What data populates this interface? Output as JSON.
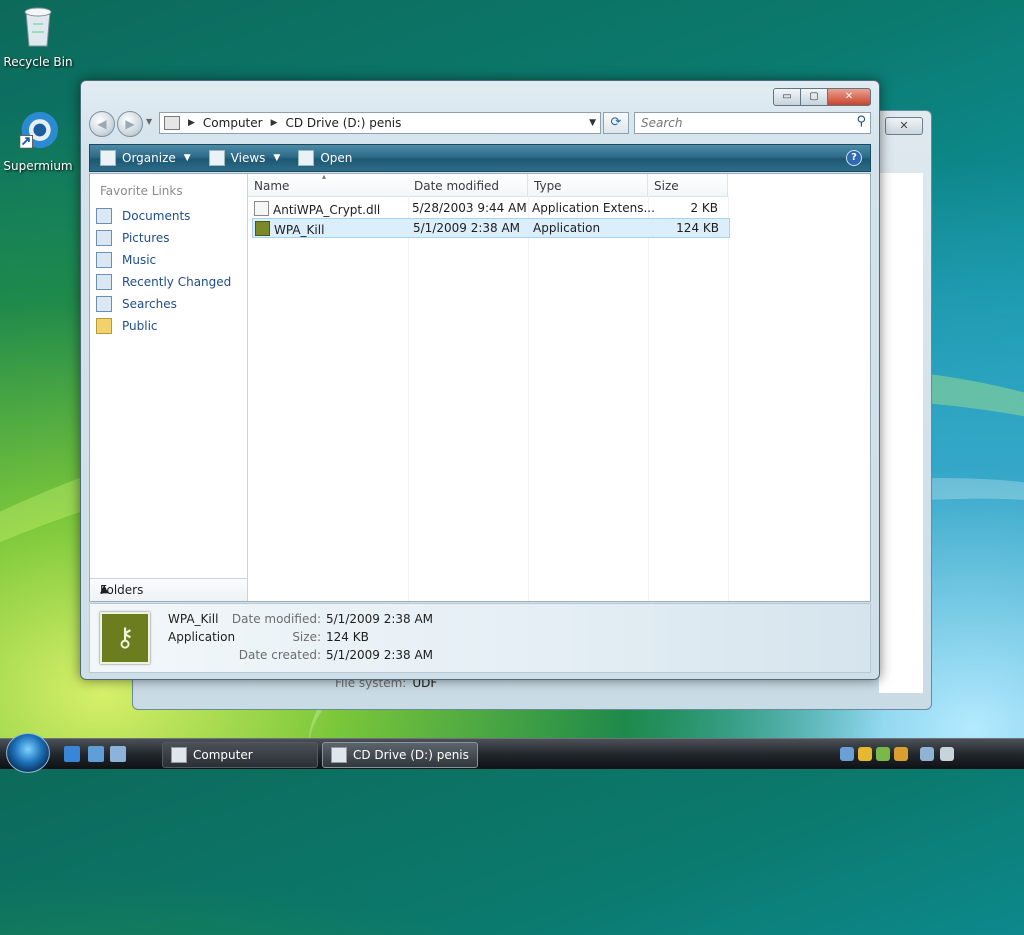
{
  "desktop": {
    "icons": [
      {
        "label": "Recycle Bin"
      },
      {
        "label": "Supermium"
      }
    ]
  },
  "window": {
    "caption_buttons": {
      "minimize": "▭",
      "maximize": "▢",
      "close": "✕"
    },
    "address": {
      "segments": [
        "Computer",
        "CD Drive (D:) penis"
      ]
    },
    "search": {
      "placeholder": "Search"
    },
    "toolbar": {
      "organize": "Organize",
      "views": "Views",
      "open": "Open",
      "help": "?"
    },
    "nav": {
      "heading": "Favorite Links",
      "items": [
        {
          "label": "Documents"
        },
        {
          "label": "Pictures"
        },
        {
          "label": "Music"
        },
        {
          "label": "Recently Changed"
        },
        {
          "label": "Searches"
        },
        {
          "label": "Public"
        }
      ],
      "folders_label": "Folders"
    },
    "columns": [
      "Name",
      "Date modified",
      "Type",
      "Size"
    ],
    "files": [
      {
        "name": "AntiWPA_Crypt.dll",
        "date": "5/28/2003 9:44 AM",
        "type": "Application Extens...",
        "size": "2 KB",
        "selected": false
      },
      {
        "name": "WPA_Kill",
        "date": "5/1/2009 2:38 AM",
        "type": "Application",
        "size": "124 KB",
        "selected": true
      }
    ],
    "details": {
      "name": "WPA_Kill",
      "type": "Application",
      "date_modified_label": "Date modified:",
      "date_modified": "5/1/2009 2:38 AM",
      "size_label": "Size:",
      "size": "124 KB",
      "date_created_label": "Date created:",
      "date_created": "5/1/2009 2:38 AM"
    }
  },
  "back_window": {
    "file_system_label": "File system:",
    "file_system": "UDF"
  },
  "taskbar": {
    "buttons": [
      {
        "label": "Computer"
      },
      {
        "label": "CD Drive (D:) penis"
      }
    ]
  },
  "colors": {
    "toolbar": "#2d6b8a",
    "link": "#204e8a",
    "selection": "#dbeefb"
  }
}
